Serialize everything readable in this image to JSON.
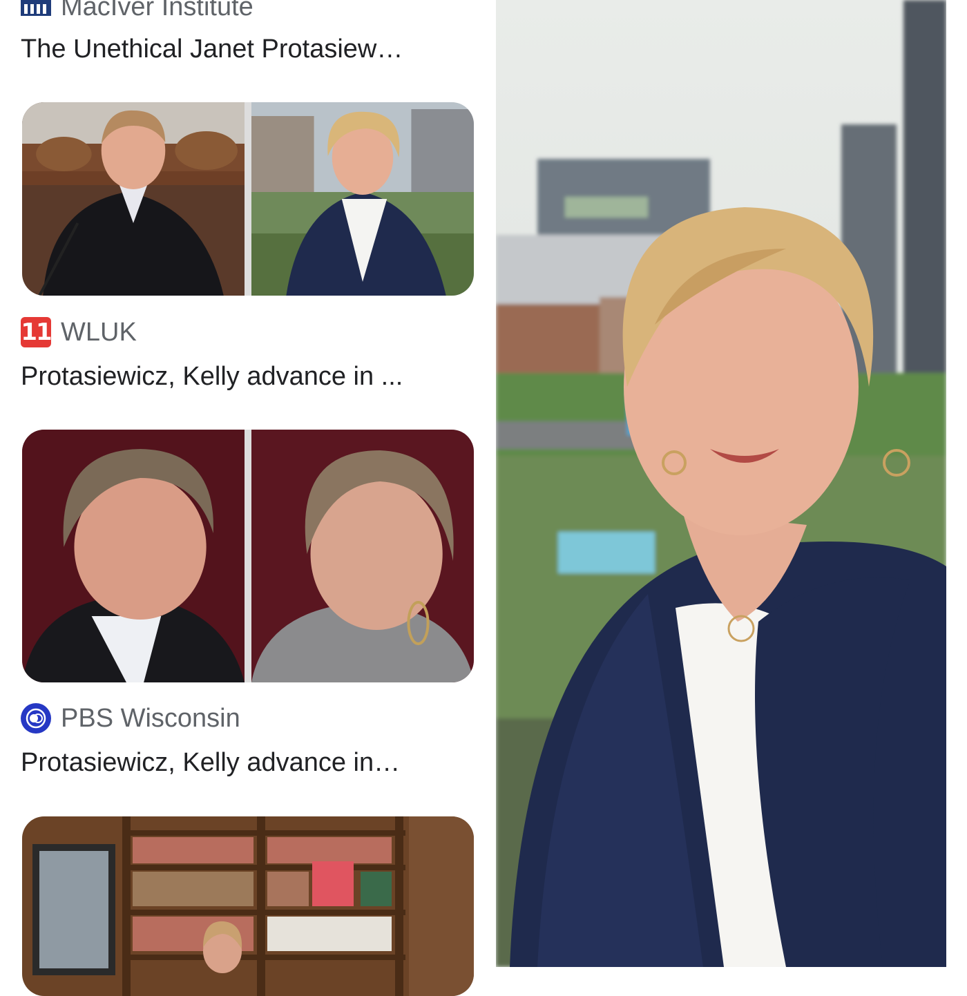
{
  "results": [
    {
      "source": "MacIver Institute",
      "source_icon": "maciver-institute-logo-icon",
      "title": "The Unethical Janet Protasiew…"
    },
    {
      "source": "WLUK",
      "source_icon": "wluk-fox11-logo-icon",
      "icon_text": "11",
      "title": "Protasiewicz, Kelly advance in ..."
    },
    {
      "source": "PBS Wisconsin",
      "source_icon": "pbs-logo-icon",
      "title": "Protasiewicz, Kelly advance in…"
    }
  ],
  "colors": {
    "source_text": "#5f6368",
    "title_text": "#202124",
    "wluk_red": "#e53935",
    "pbs_blue": "#2638c4",
    "blazer_navy": "#1f2a4d"
  }
}
